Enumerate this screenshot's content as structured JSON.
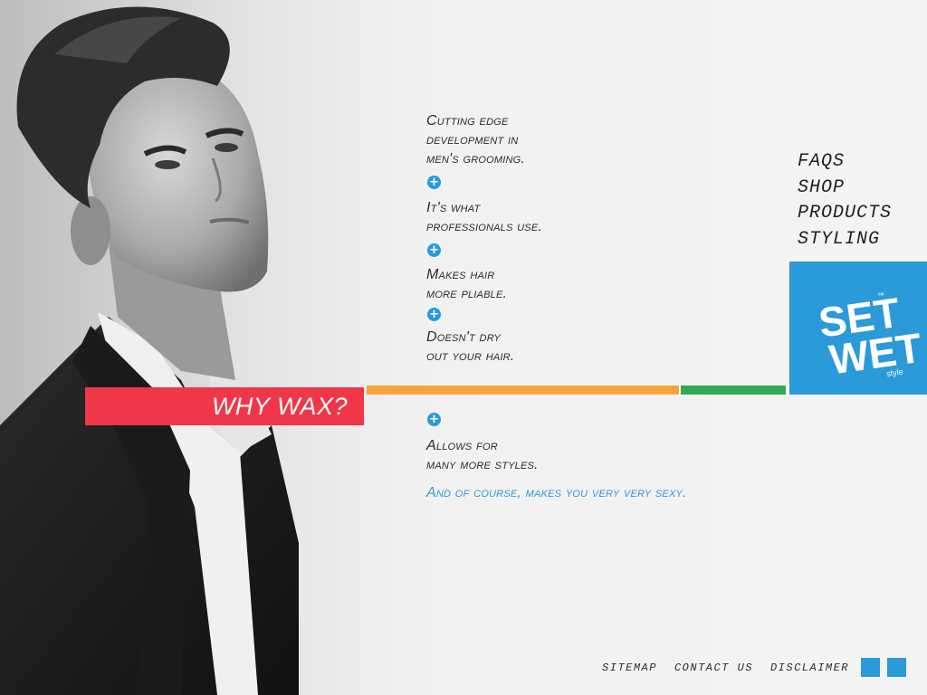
{
  "hero": {
    "photo_alt": "portrait-photo"
  },
  "features": [
    {
      "line1": "Cutting edge",
      "line2": "development in",
      "line3": "men's grooming."
    },
    {
      "line1": "It's what",
      "line2": "professionals use."
    },
    {
      "line1": "Makes hair",
      "line2": "more pliable."
    },
    {
      "line1": "Doesn't dry",
      "line2": "out your hair."
    },
    {
      "line1": "Allows for",
      "line2": "many more styles."
    }
  ],
  "plus_icon": "+",
  "tagline": "And of course, makes you very very sexy.",
  "nav": {
    "items": [
      "FAQS",
      "SHOP",
      "PRODUCTS",
      "STYLING"
    ]
  },
  "logo": {
    "line1": "SET",
    "line2": "WET",
    "sub": "style",
    "tm": "™"
  },
  "banner": {
    "label": "WHY WAX?"
  },
  "footer": {
    "links": [
      "SITEMAP",
      "CONTACT US",
      "DISCLAIMER"
    ]
  },
  "colors": {
    "accent_blue": "#2a9ad9",
    "banner_red": "#ef3749",
    "bar_orange": "#f3a73a",
    "bar_green": "#30a954"
  }
}
